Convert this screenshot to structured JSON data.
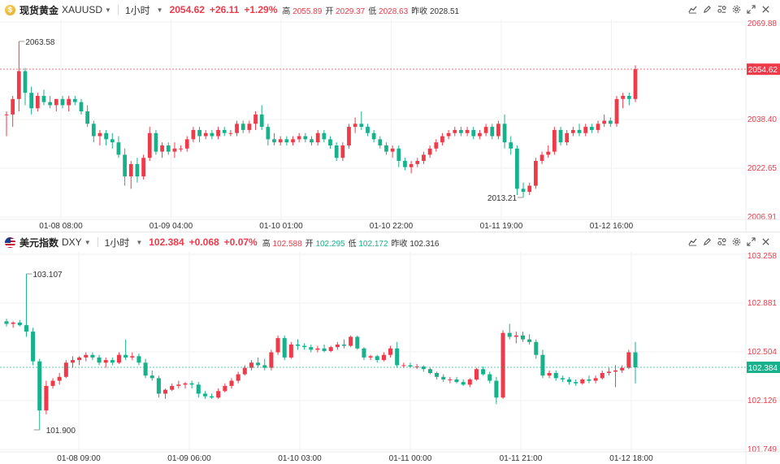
{
  "panels": {
    "gold": {
      "name": "现货黄金",
      "symbol": "XAUUSD",
      "interval": "1小时",
      "price": "2054.62",
      "change": "+26.11",
      "percent": "+1.29%",
      "high_label": "高",
      "high": "2055.89",
      "open_label": "开",
      "open": "2029.37",
      "low_label": "低",
      "low": "2028.63",
      "prev_label": "昨收",
      "prev": "2028.51",
      "price_tag": "2054.62",
      "hi_marker": "2063.58",
      "lo_marker": "2013.21"
    },
    "dxy": {
      "name": "美元指数",
      "symbol": "DXY",
      "interval": "1小时",
      "price": "102.384",
      "change": "+0.068",
      "percent": "+0.07%",
      "high_label": "高",
      "high": "102.588",
      "open_label": "开",
      "open": "102.295",
      "low_label": "低",
      "low": "102.172",
      "prev_label": "昨收",
      "prev": "102.316",
      "price_tag": "102.384",
      "hi_marker": "103.107",
      "lo_marker": "101.900"
    }
  },
  "toolbar_icons": [
    "chart-style-icon",
    "draw-icon",
    "indicators-icon",
    "settings-icon",
    "fullscreen-icon",
    "close-icon"
  ],
  "colors": {
    "up": "#ef3a4a",
    "down": "#17b28b",
    "grid": "#f0f0f0",
    "axis_text": "#333333"
  },
  "chart_data": [
    {
      "type": "candlestick",
      "series_name": "XAUUSD",
      "ylim": [
        2006.91,
        2069.88
      ],
      "y_ticks": [
        "2069.88",
        "2054.62",
        "2038.40",
        "2022.65",
        "2006.91"
      ],
      "x_ticks": [
        "01-08 08:00",
        "01-09 04:00",
        "01-10 01:00",
        "01-10 22:00",
        "01-11 19:00",
        "01-12 16:00"
      ],
      "last_price": 2054.62,
      "candles": [
        [
          2040,
          2041,
          2033,
          2040
        ],
        [
          2040,
          2046,
          2036,
          2045
        ],
        [
          2045,
          2063.58,
          2041,
          2054
        ],
        [
          2054,
          2055,
          2043,
          2047
        ],
        [
          2047,
          2049,
          2040,
          2042
        ],
        [
          2042,
          2047,
          2041,
          2046
        ],
        [
          2046,
          2048,
          2043,
          2044
        ],
        [
          2044,
          2046,
          2042,
          2043
        ],
        [
          2043,
          2045,
          2041,
          2045
        ],
        [
          2045,
          2046,
          2042,
          2043
        ],
        [
          2043,
          2046,
          2041,
          2045
        ],
        [
          2045,
          2046,
          2043,
          2044
        ],
        [
          2044,
          2045,
          2040,
          2041
        ],
        [
          2041,
          2043,
          2036,
          2037
        ],
        [
          2037,
          2038,
          2031,
          2033
        ],
        [
          2033,
          2035,
          2030,
          2034
        ],
        [
          2034,
          2035,
          2030,
          2032
        ],
        [
          2032,
          2034,
          2029,
          2031
        ],
        [
          2031,
          2033,
          2026,
          2027
        ],
        [
          2027,
          2029,
          2017,
          2020
        ],
        [
          2020,
          2025,
          2016,
          2024
        ],
        [
          2024,
          2026,
          2018,
          2020
        ],
        [
          2020,
          2027,
          2019,
          2026
        ],
        [
          2026,
          2036,
          2025,
          2034
        ],
        [
          2034,
          2035,
          2027,
          2028
        ],
        [
          2028,
          2031,
          2026,
          2030
        ],
        [
          2030,
          2031,
          2027,
          2028
        ],
        [
          2028,
          2031,
          2026,
          2029
        ],
        [
          2029,
          2030,
          2028,
          2029
        ],
        [
          2029,
          2033,
          2028,
          2032
        ],
        [
          2032,
          2036,
          2031,
          2035
        ],
        [
          2035,
          2036,
          2031,
          2033
        ],
        [
          2033,
          2035,
          2032,
          2034
        ],
        [
          2034,
          2035,
          2032,
          2033
        ],
        [
          2033,
          2036,
          2032,
          2035
        ],
        [
          2035,
          2036,
          2033,
          2034
        ],
        [
          2034,
          2035,
          2033,
          2034
        ],
        [
          2034,
          2038,
          2033,
          2037
        ],
        [
          2037,
          2038,
          2034,
          2035
        ],
        [
          2035,
          2038,
          2034,
          2037
        ],
        [
          2037,
          2041,
          2035,
          2040
        ],
        [
          2040,
          2043,
          2035,
          2036
        ],
        [
          2036,
          2037,
          2030,
          2032
        ],
        [
          2032,
          2034,
          2030,
          2031
        ],
        [
          2031,
          2033,
          2030,
          2032
        ],
        [
          2032,
          2033,
          2030,
          2031
        ],
        [
          2031,
          2033,
          2030,
          2032
        ],
        [
          2032,
          2034,
          2031,
          2033
        ],
        [
          2033,
          2034,
          2031,
          2032
        ],
        [
          2032,
          2033,
          2030,
          2031
        ],
        [
          2031,
          2035,
          2030,
          2034
        ],
        [
          2034,
          2035,
          2031,
          2032
        ],
        [
          2032,
          2033,
          2029,
          2030
        ],
        [
          2030,
          2031,
          2025,
          2026
        ],
        [
          2026,
          2031,
          2025,
          2030
        ],
        [
          2030,
          2037,
          2029,
          2036
        ],
        [
          2036,
          2039,
          2034,
          2037
        ],
        [
          2037,
          2041,
          2035,
          2036
        ],
        [
          2036,
          2037,
          2033,
          2034
        ],
        [
          2034,
          2035,
          2031,
          2032
        ],
        [
          2032,
          2033,
          2029,
          2030
        ],
        [
          2030,
          2031,
          2027,
          2028
        ],
        [
          2028,
          2030,
          2026,
          2029
        ],
        [
          2029,
          2030,
          2023,
          2025
        ],
        [
          2025,
          2026,
          2022,
          2023
        ],
        [
          2023,
          2025,
          2021,
          2024
        ],
        [
          2024,
          2026,
          2023,
          2025
        ],
        [
          2025,
          2028,
          2024,
          2027
        ],
        [
          2027,
          2030,
          2026,
          2029
        ],
        [
          2029,
          2032,
          2028,
          2031
        ],
        [
          2031,
          2034,
          2030,
          2033
        ],
        [
          2033,
          2035,
          2032,
          2034
        ],
        [
          2034,
          2036,
          2033,
          2035
        ],
        [
          2035,
          2036,
          2033,
          2034
        ],
        [
          2034,
          2036,
          2033,
          2035
        ],
        [
          2035,
          2036,
          2032,
          2033
        ],
        [
          2033,
          2035,
          2032,
          2034
        ],
        [
          2034,
          2037,
          2033,
          2036
        ],
        [
          2036,
          2037,
          2032,
          2033
        ],
        [
          2033,
          2038,
          2032,
          2037
        ],
        [
          2037,
          2040,
          2029,
          2031
        ],
        [
          2031,
          2033,
          2027,
          2029
        ],
        [
          2029,
          2030,
          2014,
          2016
        ],
        [
          2016,
          2018,
          2013.21,
          2015
        ],
        [
          2015,
          2018,
          2014,
          2017
        ],
        [
          2017,
          2026,
          2016,
          2025
        ],
        [
          2025,
          2028,
          2024,
          2027
        ],
        [
          2027,
          2030,
          2026,
          2028
        ],
        [
          2028,
          2036,
          2027,
          2035
        ],
        [
          2035,
          2036,
          2030,
          2031
        ],
        [
          2031,
          2035,
          2030,
          2034
        ],
        [
          2034,
          2036,
          2033,
          2035
        ],
        [
          2035,
          2037,
          2033,
          2034
        ],
        [
          2034,
          2037,
          2033,
          2036
        ],
        [
          2036,
          2037,
          2034,
          2035
        ],
        [
          2035,
          2038,
          2034,
          2037
        ],
        [
          2037,
          2040,
          2036,
          2038
        ],
        [
          2038,
          2039,
          2036,
          2037
        ],
        [
          2037,
          2046,
          2036,
          2045
        ],
        [
          2045,
          2047,
          2042,
          2046
        ],
        [
          2046,
          2047,
          2043,
          2045
        ],
        [
          2045,
          2055.89,
          2044,
          2054.62
        ]
      ]
    },
    {
      "type": "candlestick",
      "series_name": "DXY",
      "ylim": [
        101.749,
        103.258
      ],
      "y_ticks": [
        "103.258",
        "102.881",
        "102.504",
        "102.384",
        "102.126",
        "101.749"
      ],
      "x_ticks": [
        "01-08 09:00",
        "01-09 06:00",
        "01-10 03:00",
        "01-11 00:00",
        "01-11 21:00",
        "01-12 18:00"
      ],
      "last_price": 102.384,
      "candles": [
        [
          102.74,
          102.76,
          102.7,
          102.72
        ],
        [
          102.72,
          102.74,
          102.69,
          102.73
        ],
        [
          102.73,
          102.75,
          102.7,
          102.71
        ],
        [
          102.71,
          103.107,
          102.62,
          102.66
        ],
        [
          102.66,
          102.69,
          102.4,
          102.43
        ],
        [
          102.43,
          102.45,
          101.9,
          102.05
        ],
        [
          102.05,
          102.28,
          102.02,
          102.24
        ],
        [
          102.24,
          102.3,
          102.22,
          102.28
        ],
        [
          102.28,
          102.34,
          102.25,
          102.31
        ],
        [
          102.31,
          102.44,
          102.3,
          102.42
        ],
        [
          102.42,
          102.47,
          102.38,
          102.44
        ],
        [
          102.44,
          102.47,
          102.4,
          102.46
        ],
        [
          102.46,
          102.5,
          102.43,
          102.48
        ],
        [
          102.48,
          102.5,
          102.44,
          102.46
        ],
        [
          102.46,
          102.48,
          102.4,
          102.42
        ],
        [
          102.42,
          102.46,
          102.38,
          102.44
        ],
        [
          102.44,
          102.46,
          102.4,
          102.42
        ],
        [
          102.42,
          102.5,
          102.41,
          102.48
        ],
        [
          102.48,
          102.6,
          102.44,
          102.46
        ],
        [
          102.46,
          102.5,
          102.44,
          102.47
        ],
        [
          102.47,
          102.49,
          102.4,
          102.42
        ],
        [
          102.42,
          102.45,
          102.3,
          102.32
        ],
        [
          102.32,
          102.36,
          102.28,
          102.3
        ],
        [
          102.3,
          102.32,
          102.15,
          102.18
        ],
        [
          102.18,
          102.22,
          102.14,
          102.21
        ],
        [
          102.21,
          102.26,
          102.2,
          102.24
        ],
        [
          102.24,
          102.28,
          102.22,
          102.25
        ],
        [
          102.25,
          102.27,
          102.22,
          102.26
        ],
        [
          102.26,
          102.28,
          102.22,
          102.25
        ],
        [
          102.25,
          102.27,
          102.15,
          102.18
        ],
        [
          102.18,
          102.2,
          102.14,
          102.16
        ],
        [
          102.16,
          102.18,
          102.14,
          102.15
        ],
        [
          102.15,
          102.22,
          102.14,
          102.2
        ],
        [
          102.2,
          102.26,
          102.19,
          102.24
        ],
        [
          102.24,
          102.3,
          102.22,
          102.28
        ],
        [
          102.28,
          102.35,
          102.26,
          102.33
        ],
        [
          102.33,
          102.4,
          102.32,
          102.38
        ],
        [
          102.38,
          102.44,
          102.36,
          102.42
        ],
        [
          102.42,
          102.46,
          102.38,
          102.4
        ],
        [
          102.4,
          102.45,
          102.36,
          102.38
        ],
        [
          102.38,
          102.52,
          102.36,
          102.5
        ],
        [
          102.5,
          102.63,
          102.48,
          102.61
        ],
        [
          102.61,
          102.63,
          102.44,
          102.46
        ],
        [
          102.46,
          102.58,
          102.45,
          102.56
        ],
        [
          102.56,
          102.6,
          102.52,
          102.55
        ],
        [
          102.55,
          102.57,
          102.52,
          102.54
        ],
        [
          102.54,
          102.56,
          102.5,
          102.52
        ],
        [
          102.52,
          102.55,
          102.5,
          102.53
        ],
        [
          102.53,
          102.56,
          102.5,
          102.51
        ],
        [
          102.51,
          102.55,
          102.5,
          102.54
        ],
        [
          102.54,
          102.58,
          102.52,
          102.56
        ],
        [
          102.56,
          102.6,
          102.53,
          102.55
        ],
        [
          102.55,
          102.63,
          102.54,
          102.62
        ],
        [
          102.62,
          102.63,
          102.52,
          102.53
        ],
        [
          102.53,
          102.54,
          102.44,
          102.46
        ],
        [
          102.46,
          102.48,
          102.44,
          102.47
        ],
        [
          102.47,
          102.48,
          102.42,
          102.44
        ],
        [
          102.44,
          102.5,
          102.43,
          102.48
        ],
        [
          102.48,
          102.55,
          102.46,
          102.53
        ],
        [
          102.53,
          102.58,
          102.38,
          102.4
        ],
        [
          102.4,
          102.42,
          102.38,
          102.4
        ],
        [
          102.4,
          102.42,
          102.38,
          102.39
        ],
        [
          102.39,
          102.41,
          102.37,
          102.39
        ],
        [
          102.39,
          102.4,
          102.35,
          102.37
        ],
        [
          102.37,
          102.38,
          102.33,
          102.34
        ],
        [
          102.34,
          102.35,
          102.29,
          102.31
        ],
        [
          102.31,
          102.33,
          102.27,
          102.29
        ],
        [
          102.29,
          102.31,
          102.26,
          102.29
        ],
        [
          102.29,
          102.31,
          102.26,
          102.27
        ],
        [
          102.27,
          102.29,
          102.24,
          102.25
        ],
        [
          102.25,
          102.3,
          102.23,
          102.29
        ],
        [
          102.29,
          102.38,
          102.28,
          102.37
        ],
        [
          102.37,
          102.39,
          102.32,
          102.33
        ],
        [
          102.33,
          102.35,
          102.26,
          102.28
        ],
        [
          102.28,
          102.31,
          102.1,
          102.15
        ],
        [
          102.15,
          102.67,
          102.14,
          102.65
        ],
        [
          102.65,
          102.72,
          102.6,
          102.62
        ],
        [
          102.62,
          102.66,
          102.57,
          102.63
        ],
        [
          102.63,
          102.66,
          102.58,
          102.6
        ],
        [
          102.6,
          102.64,
          102.56,
          102.58
        ],
        [
          102.58,
          102.6,
          102.45,
          102.48
        ],
        [
          102.48,
          102.52,
          102.3,
          102.32
        ],
        [
          102.32,
          102.36,
          102.3,
          102.34
        ],
        [
          102.34,
          102.36,
          102.28,
          102.3
        ],
        [
          102.3,
          102.32,
          102.27,
          102.29
        ],
        [
          102.29,
          102.31,
          102.25,
          102.27
        ],
        [
          102.27,
          102.29,
          102.24,
          102.26
        ],
        [
          102.26,
          102.3,
          102.25,
          102.29
        ],
        [
          102.29,
          102.32,
          102.26,
          102.28
        ],
        [
          102.28,
          102.32,
          102.26,
          102.3
        ],
        [
          102.3,
          102.36,
          102.29,
          102.34
        ],
        [
          102.34,
          102.38,
          102.32,
          102.35
        ],
        [
          102.35,
          102.4,
          102.23,
          102.36
        ],
        [
          102.36,
          102.4,
          102.34,
          102.38
        ],
        [
          102.38,
          102.52,
          102.37,
          102.5
        ],
        [
          102.5,
          102.58,
          102.26,
          102.384
        ]
      ]
    }
  ]
}
